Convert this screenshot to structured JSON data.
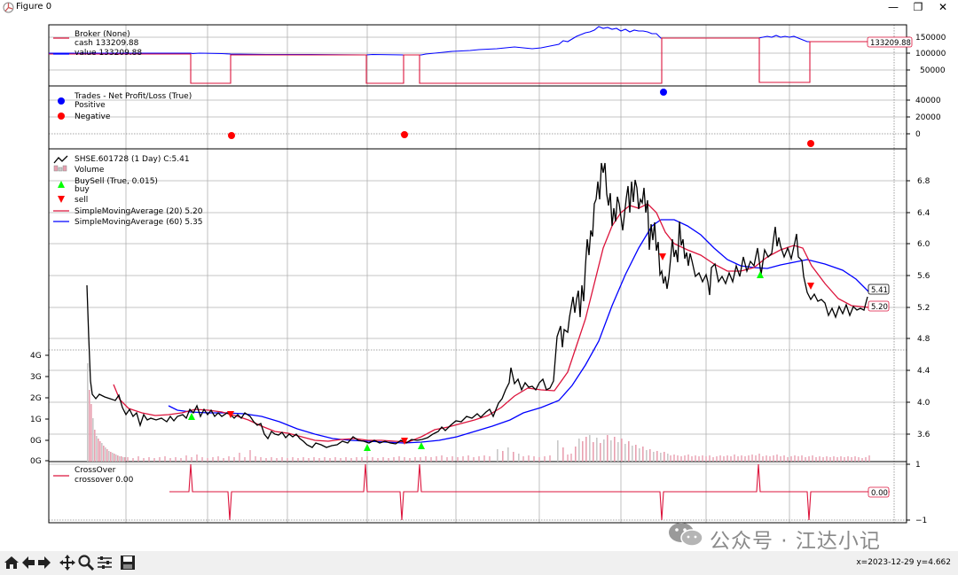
{
  "window": {
    "title": "Figure 0",
    "minimize": "—",
    "restore": "❐",
    "close": "✕"
  },
  "panels": {
    "broker": {
      "legend_title": "Broker (None)",
      "cash_label": "cash 133209.88",
      "value_label": "value 133209.88",
      "yticks": [
        "150000",
        "100000",
        "50000"
      ],
      "last_value_box": "133209.88",
      "cash_color": "#dc143c",
      "value_color": "#0000ff"
    },
    "trades": {
      "legend_title": "Trades - Net Profit/Loss (True)",
      "positive_label": "Positive",
      "negative_label": "Negative",
      "yticks": [
        "40000",
        "20000",
        "0"
      ],
      "positive_color": "#0000ff",
      "negative_color": "#ff0000"
    },
    "price": {
      "legend_title": "SHSE.601728 (1 Day) C:5.41",
      "volume_label": "Volume",
      "buysell_label": "BuySell (True, 0.015)",
      "buy_label": "buy",
      "sell_label": "sell",
      "sma20_label": "SimpleMovingAverage (20) 5.20",
      "sma60_label": "SimpleMovingAverage (60) 5.35",
      "price_yticks": [
        "6.8",
        "6.4",
        "6.0",
        "5.6",
        "5.2",
        "4.8",
        "4.4",
        "4.0",
        "3.6"
      ],
      "volume_yticks": [
        "4G",
        "3G",
        "2G",
        "1G",
        "0G",
        "0G"
      ],
      "last_close_box": "5.41",
      "last_sma20_box": "5.20",
      "buy_color": "#00ff00",
      "sell_color": "#ff0000",
      "sma20_color": "#dc143c",
      "sma60_color": "#0000ff"
    },
    "crossover": {
      "legend_title": "CrossOver",
      "crossover_label": "crossover 0.00",
      "yticks": [
        "1",
        "−1"
      ],
      "last_value_box": "0.00",
      "color": "#dc143c"
    }
  },
  "toolbar": {
    "icons": [
      "home-icon",
      "back-icon",
      "forward-icon",
      "pan-icon",
      "zoom-icon",
      "configure-subplots-icon",
      "save-icon"
    ],
    "coordinates": "x=2023-12-29 y=4.662"
  },
  "watermark": {
    "text": "公众号 · 江达小记"
  }
}
